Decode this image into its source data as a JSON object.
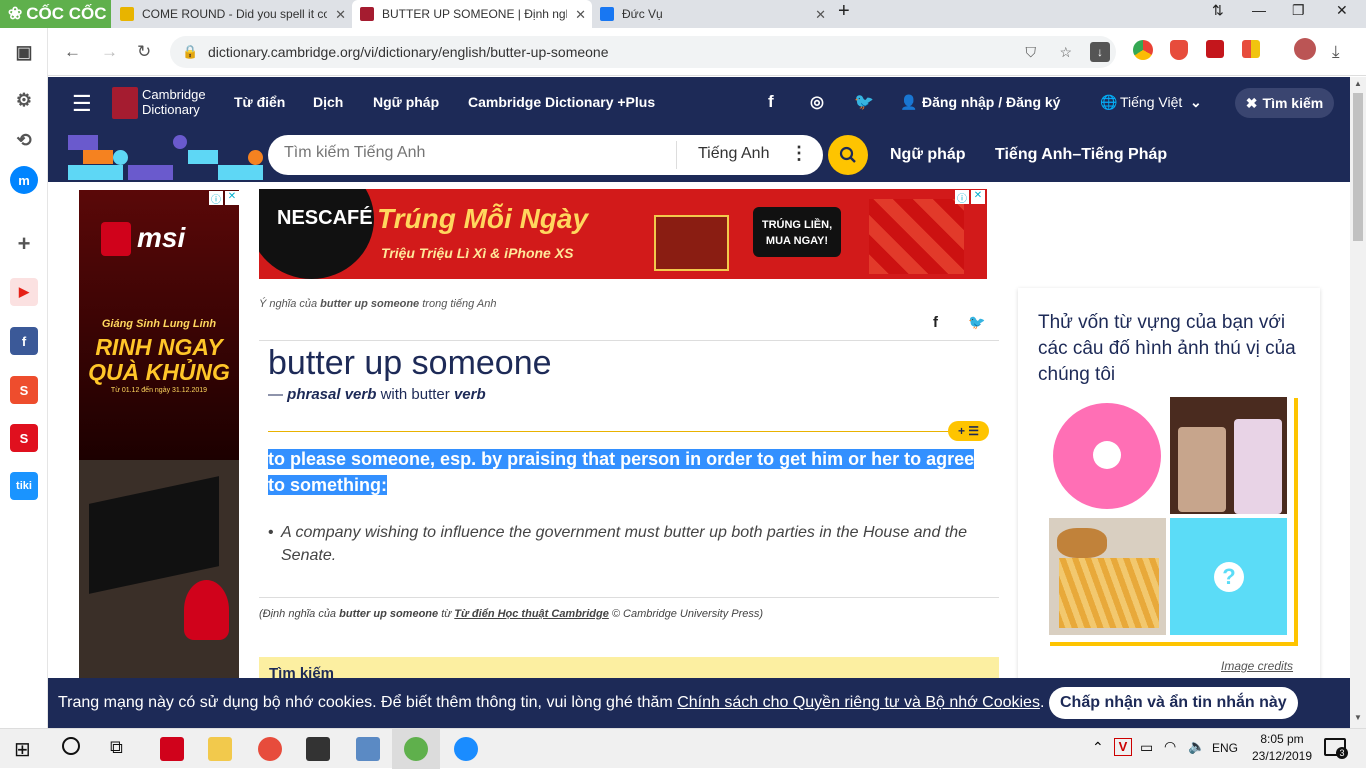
{
  "browser": {
    "brand": "CỐC CỐC",
    "tabs": [
      {
        "title": "COME ROUND - Did you spell it co",
        "color": "#e8b400"
      },
      {
        "title": "BUTTER UP SOMEONE | Định nghĩ",
        "color": "#a51c30"
      },
      {
        "title": "Đức Vụ",
        "color": "#1877f2"
      }
    ],
    "url": "dictionary.cambridge.org/vi/dictionary/english/butter-up-someone"
  },
  "site": {
    "logo_line1": "Cambridge",
    "logo_line2": "Dictionary",
    "nav": [
      "Từ điển",
      "Dịch",
      "Ngữ pháp",
      "Cambridge Dictionary +Plus"
    ],
    "login": "Đăng nhập / Đăng ký",
    "language": "Tiếng Việt",
    "search_button": "Tìm kiếm",
    "search_placeholder": "Tìm kiếm Tiếng Anh",
    "search_dict": "Tiếng Anh",
    "secondary_nav": [
      "Ngữ pháp",
      "Tiếng Anh–Tiếng Pháp"
    ]
  },
  "ads": {
    "left_brand": "msi",
    "left_headline": "Giáng Sinh Lung Linh",
    "left_big": "RINH NGAY QUÀ KHỦNG",
    "left_dates": "Từ 01.12 đến ngày 31.12.2019",
    "top_brand": "NESCAFÉ",
    "top_headline": "Trúng Mỗi Ngày",
    "top_sub": "Triệu Triệu Lì Xì & iPhone XS",
    "top_badge": "TRÚNG LIỀN, MUA NGAY!"
  },
  "entry": {
    "breadcrumb_prefix": "Ý nghĩa của",
    "breadcrumb_word": "butter up someone",
    "breadcrumb_suffix": "trong tiếng Anh",
    "headword": "butter up someone",
    "pos_dash": "—",
    "pos": "phrasal verb",
    "pos_with": "with butter",
    "pos_verb": "verb",
    "definition": "to please someone, esp. by praising that person in order to get him or her to agree to something:",
    "example": "A company wishing to influence the government must butter up both parties in the House and the Senate.",
    "source_prefix": "(Định nghĩa của",
    "source_word": "butter up someone",
    "source_from": "từ",
    "source_link": "Từ điển Học thuật Cambridge",
    "source_suffix": "© Cambridge University Press)",
    "next_box": "Tìm kiếm"
  },
  "quiz": {
    "text": "Thử vốn từ vựng của bạn với các câu đố hình ảnh thú vị của chúng tôi",
    "credits": "Image credits",
    "unknown": "?"
  },
  "cookie": {
    "text": "Trang mạng này có sử dụng bộ nhớ cookies. Để biết thêm thông tin, vui lòng ghé thăm",
    "link": "Chính sách cho Quyền riêng tư và Bộ nhớ Cookies",
    "button": "Chấp nhận và ẩn tin nhắn này"
  },
  "taskbar": {
    "lang": "ENG",
    "time": "8:05 pm",
    "date": "23/12/2019",
    "notif": "3"
  }
}
